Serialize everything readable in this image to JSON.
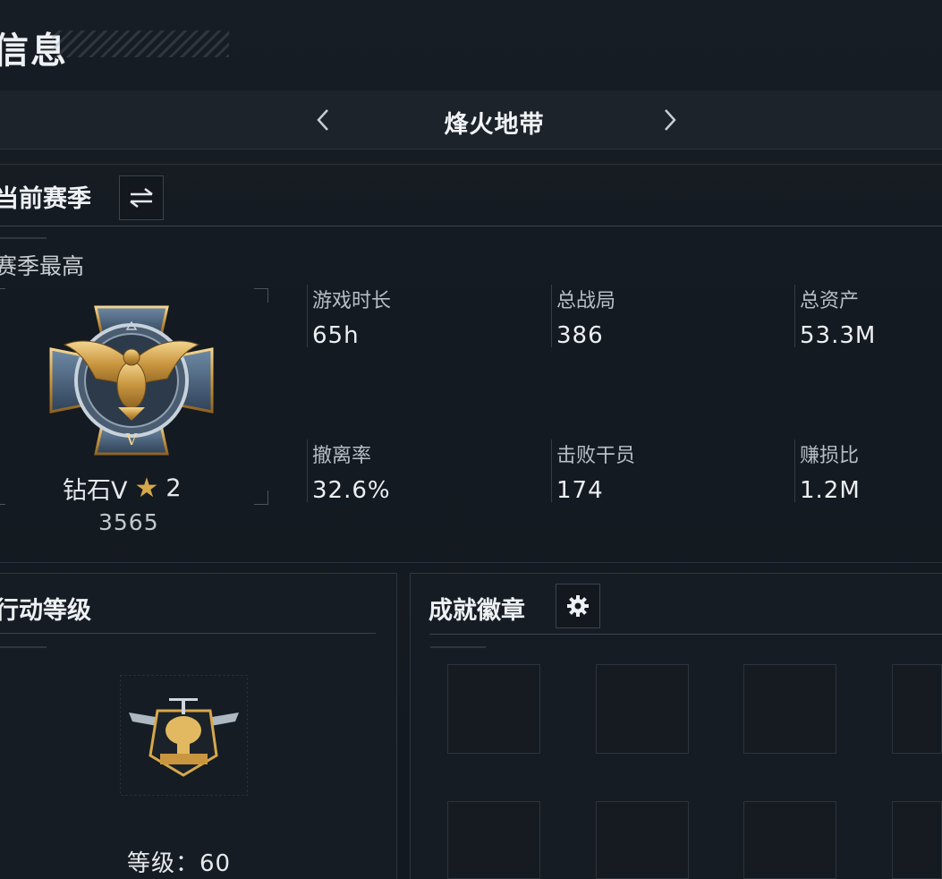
{
  "header": {
    "title": "信息"
  },
  "mode_bar": {
    "mode_name": "烽火地带"
  },
  "season": {
    "title": "当前赛季",
    "high_label": "赛季最高",
    "rank": {
      "name": "钻石V",
      "stars": "2",
      "score": "3565",
      "tier_numeral": "V"
    }
  },
  "stats": [
    {
      "label": "游戏时长",
      "value": "65h"
    },
    {
      "label": "总战局",
      "value": "386"
    },
    {
      "label": "总资产",
      "value": "53.3M"
    },
    {
      "label": "撤离率",
      "value": "32.6%"
    },
    {
      "label": "击败干员",
      "value": "174"
    },
    {
      "label": "赚损比",
      "value": "1.2M"
    }
  ],
  "operation_level": {
    "title": "行动等级",
    "level_text": "等级：60"
  },
  "achievements": {
    "title": "成就徽章"
  },
  "colors": {
    "accent_gold": "#d6a84a",
    "background": "#151b22"
  },
  "icons": [
    "chevron-left-icon",
    "chevron-right-icon",
    "swap-icon",
    "star-icon",
    "gear-icon",
    "rank-emblem-icon",
    "helicopter-badge-icon"
  ]
}
